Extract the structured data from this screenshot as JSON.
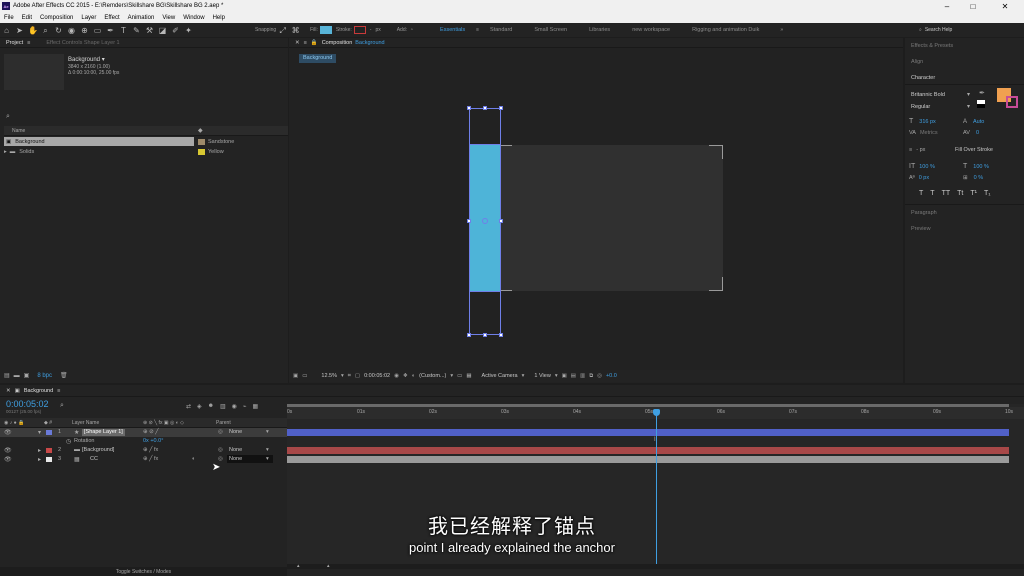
{
  "window": {
    "title": "Adobe After Effects CC 2015 - E:\\Remders\\Skillshare BG\\Skillshare BG 2.aep *",
    "app_badge": "Ae"
  },
  "menu": [
    "File",
    "Edit",
    "Composition",
    "Layer",
    "Effect",
    "Animation",
    "View",
    "Window",
    "Help"
  ],
  "toolbar": {
    "snapping": "Snapping",
    "fill_label": "Fill:",
    "stroke_label": "Stroke:",
    "stroke_width": "-",
    "stroke_unit": "px",
    "add_label": "Add:",
    "fill_color": "#58b4d8",
    "stroke_color": "#c83a3a",
    "workspaces": [
      "Essentials",
      "Standard",
      "Small Screen",
      "Libraries",
      "new workspace",
      "Rigging and animation Duik"
    ],
    "active_workspace": "Essentials",
    "search_help": "Search Help"
  },
  "project": {
    "tab_project": "Project",
    "tab_effects": "Effect Controls Shape Layer 1",
    "preview_name": "Background",
    "preview_dims": "3840 x 2160 (1.00)",
    "preview_duration": "Δ 0:00:10:00, 25.00 fps",
    "search_placeholder": "",
    "col_name": "Name",
    "items": [
      {
        "name": "Background",
        "label": "Sandstone",
        "label_color": "#9e8a6a",
        "selected": true
      },
      {
        "name": "Solids",
        "label": "Yellow",
        "label_color": "#d8c832",
        "selected": false
      }
    ],
    "bpc": "8 bpc"
  },
  "composition": {
    "tab_title": "Composition",
    "comp_name": "Background",
    "breadcrumb": "Background",
    "zoom": "12.5%",
    "timecode": "0:00:05:02",
    "resolution": "(Custom...)",
    "camera": "Active Camera",
    "views": "1 View",
    "exposure": "+0.0",
    "shape_color": "#4eb4d8",
    "bg_color": "#303030"
  },
  "right_panel": {
    "effects_presets": "Effects & Presets",
    "align": "Align",
    "character": "Character",
    "font": "Britannic Bold",
    "style": "Regular",
    "font_size": "316 px",
    "leading": "Auto",
    "kerning": "Metrics",
    "tracking": "0",
    "stroke_px": "- px",
    "stroke_mode": "Fill Over Stroke",
    "vscale": "100 %",
    "hscale": "100 %",
    "baseline": "0 px",
    "tsume": "0 %",
    "text_styles": [
      "T",
      "T",
      "TT",
      "Tt",
      "T¹",
      "T₁"
    ],
    "paragraph": "Paragraph",
    "preview": "Preview",
    "fill_swatch": "#f0a050"
  },
  "timeline": {
    "tab": "Background",
    "timecode": "0:00:05:02",
    "frame_info": "00127 (25.00 fps)",
    "col_layer_name": "Layer Name",
    "col_parent": "Parent",
    "ruler": [
      "0s",
      "01s",
      "02s",
      "03s",
      "04s",
      "05s",
      "06s",
      "07s",
      "08s",
      "09s",
      "10s"
    ],
    "playhead_fraction": 0.508,
    "layers": [
      {
        "num": "1",
        "name": "[Shape Layer 1]",
        "color": "#6a7ad8",
        "parent": "None",
        "bar_color": "#5060c8",
        "selected": true
      },
      {
        "num": "2",
        "name": "[Background]",
        "color": "#c84848",
        "parent": "None",
        "bar_color": "#a84848",
        "selected": false
      },
      {
        "num": "3",
        "name": "CC",
        "color": "#e8e8e8",
        "parent": "None",
        "bar_color": "#9a9a9a",
        "selected": false
      }
    ],
    "rotation_label": "Rotation",
    "rotation_value": "0x +0.0°",
    "toggle_label": "Toggle Switches / Modes"
  },
  "subtitles": {
    "chinese": "我已经解释了锚点",
    "english": "point I already explained the anchor"
  }
}
